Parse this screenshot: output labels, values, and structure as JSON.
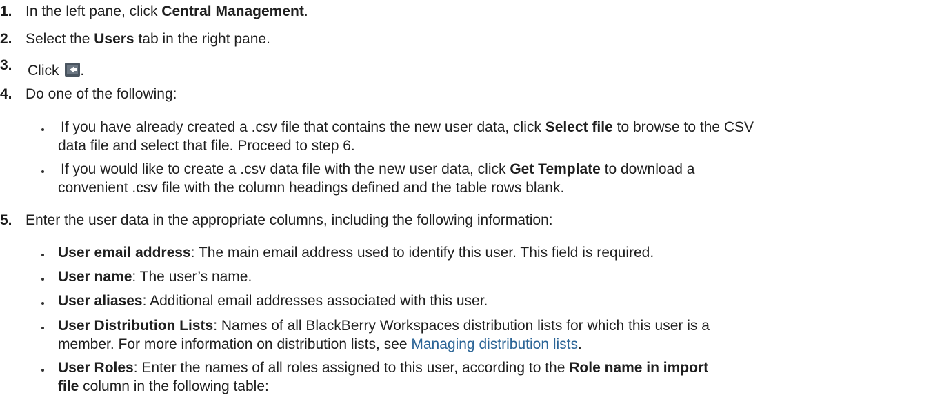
{
  "steps": {
    "s1": {
      "num": "1.",
      "pre": "In the left pane, click ",
      "bold": "Central Management",
      "post": "."
    },
    "s2": {
      "num": "2.",
      "pre": "Select the ",
      "bold": "Users",
      "post": " tab in the right pane."
    },
    "s3": {
      "num": "3.",
      "pre": "Click ",
      "icon": "import-users-icon",
      "post": "."
    },
    "s4": {
      "num": "4.",
      "text": "Do one of the following:"
    },
    "s5": {
      "num": "5.",
      "text": "Enter the user data in the appropriate columns, including the following information:"
    }
  },
  "step4_bullets": {
    "b1": {
      "line1_pre": "If you have already created a .csv file that contains the new user data, click ",
      "line1_bold": "Select file",
      "line1_post": " to browse to the CSV",
      "line2": "data file and select that file. Proceed to step 6."
    },
    "b2": {
      "line1_pre": "If you would like to create a .csv data file with the new user data, click ",
      "line1_bold": "Get Template",
      "line1_post": " to download a",
      "line2": "convenient .csv file with the column headings defined and the table rows blank."
    }
  },
  "step5_bullets": {
    "b1": {
      "bold": "User email address",
      "text": ": The main email address used to identify this user. This field is required."
    },
    "b2": {
      "bold": "User name",
      "text": ": The user’s name."
    },
    "b3": {
      "bold": "User aliases",
      "text": ": Additional email addresses associated with this user."
    },
    "b4": {
      "bold": "User Distribution Lists",
      "text": ": Names of all BlackBerry Workspaces distribution lists for which this user is a",
      "line2_pre": "member. For more information on distribution lists, see ",
      "line2_link": "Managing distribution lists",
      "line2_post": "."
    },
    "b5": {
      "bold": "User Roles",
      "text": ": Enter the names of all roles assigned to this user, according to the ",
      "bold2": "Role name in import",
      "line2_bold": "file",
      "line2_post": " column in the following table:"
    }
  },
  "colors": {
    "link": "#2a6496",
    "icon_bg": "#4a5560",
    "icon_arrow": "#ffffff"
  }
}
